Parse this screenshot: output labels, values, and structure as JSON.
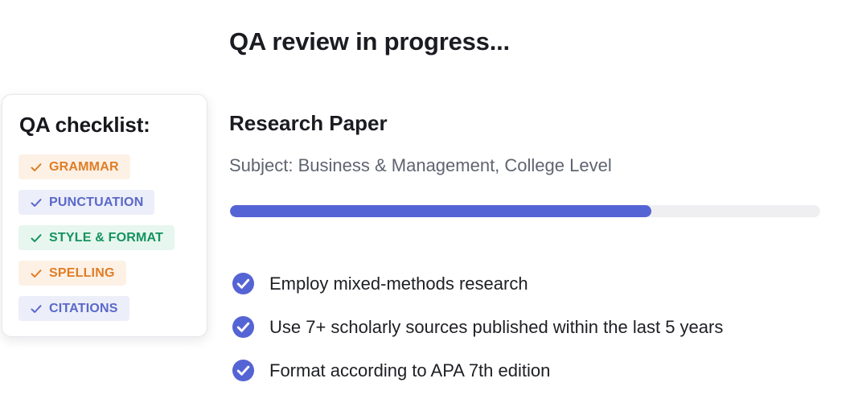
{
  "header": {
    "title": "QA review in progress..."
  },
  "checklist": {
    "title": "QA checklist:",
    "items": [
      {
        "label": "GRAMMAR",
        "icon": "check-icon",
        "color": "orange"
      },
      {
        "label": "PUNCTUATION",
        "icon": "check-icon",
        "color": "blue"
      },
      {
        "label": "STYLE & FORMAT",
        "icon": "check-icon",
        "color": "green"
      },
      {
        "label": "SPELLING",
        "icon": "check-icon",
        "color": "orange"
      },
      {
        "label": "CITATIONS",
        "icon": "check-icon",
        "color": "blue"
      }
    ]
  },
  "paper": {
    "title": "Research Paper",
    "subject": "Subject: Business & Management, College Level",
    "progress_fraction": 0.714
  },
  "requirements": [
    {
      "text": "Employ mixed-methods research",
      "icon": "check-circle-icon"
    },
    {
      "text": "Use 7+ scholarly sources published within the last 5 years",
      "icon": "check-circle-icon"
    },
    {
      "text": "Format according to APA 7th edition",
      "icon": "check-circle-icon"
    }
  ],
  "colors": {
    "accent": "#5564d4",
    "orange_text": "#e07d25",
    "orange_bg": "#fdf1e6",
    "blue_text": "#5a68c9",
    "blue_bg": "#eceef9",
    "green_text": "#15935e",
    "green_bg": "#e7f6ef"
  }
}
